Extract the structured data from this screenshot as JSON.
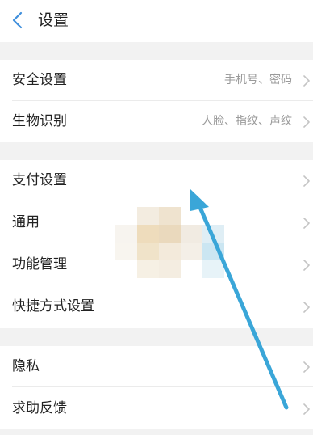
{
  "header": {
    "title": "设置"
  },
  "sections": [
    {
      "items": [
        {
          "label": "安全设置",
          "value": "手机号、密码"
        },
        {
          "label": "生物识别",
          "value": "人脸、指纹、声纹"
        }
      ]
    },
    {
      "items": [
        {
          "label": "支付设置",
          "value": ""
        },
        {
          "label": "通用",
          "value": ""
        },
        {
          "label": "功能管理",
          "value": ""
        },
        {
          "label": "快捷方式设置",
          "value": ""
        }
      ]
    },
    {
      "items": [
        {
          "label": "隐私",
          "value": ""
        },
        {
          "label": "求助反馈",
          "value": ""
        }
      ]
    }
  ],
  "colors": {
    "accent": "#3f8fdc",
    "annotation_arrow": "#3aa6d8",
    "background": "#f2f2f2",
    "text_primary": "#222222",
    "text_secondary": "#9a9a9a"
  },
  "icons": {
    "back": "chevron-left-icon",
    "row_arrow": "chevron-right-icon"
  }
}
